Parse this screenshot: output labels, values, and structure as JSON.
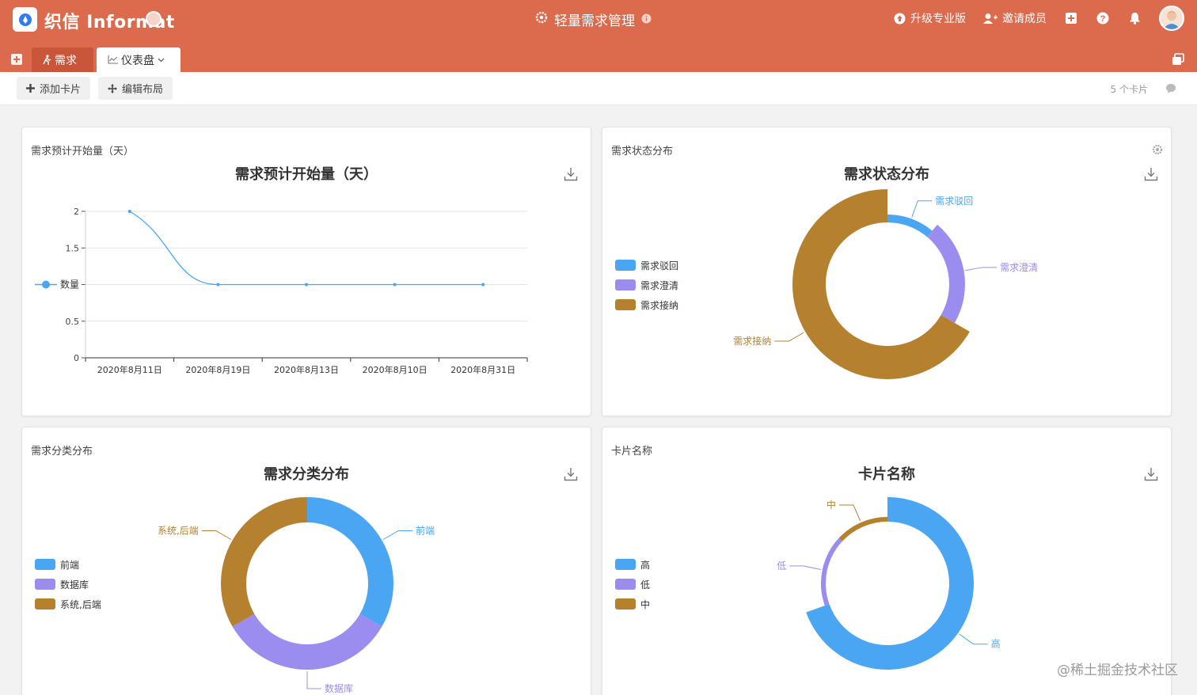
{
  "header": {
    "brand": "织信 Informat",
    "app_title": "轻量需求管理",
    "upgrade": "升级专业版",
    "invite": "邀请成员"
  },
  "tabs": [
    {
      "label": "需求"
    },
    {
      "label": "仪表盘"
    }
  ],
  "toolbar": {
    "add_card": "添加卡片",
    "edit_layout": "编辑布局",
    "card_count": "5 个卡片"
  },
  "colors": {
    "brand": "#dc6a4d",
    "blue": "#4aa6f3",
    "purple": "#9b8cf0",
    "brown": "#b5812f"
  },
  "cards": [
    {
      "label": "需求预计开始量（天）",
      "title": "需求预计开始量（天）"
    },
    {
      "label": "需求状态分布",
      "title": "需求状态分布"
    },
    {
      "label": "需求分类分布",
      "title": "需求分类分布"
    },
    {
      "label": "卡片名称",
      "title": "卡片名称"
    }
  ],
  "chart_data": [
    {
      "type": "line",
      "title": "需求预计开始量（天）",
      "categories": [
        "2020年8月11日",
        "2020年8月19日",
        "2020年8月13日",
        "2020年8月10日",
        "2020年8月31日"
      ],
      "series": [
        {
          "name": "数量",
          "values": [
            2,
            1,
            1,
            1,
            1
          ]
        }
      ],
      "ylim": [
        0,
        2
      ],
      "yticks": [
        "0",
        "0.5",
        "1",
        "1.5",
        "2"
      ],
      "yticks_shown": [
        "0",
        "0.5",
        "",
        "1.5",
        "2"
      ],
      "grid": true,
      "legend": "left"
    },
    {
      "type": "pie",
      "title": "需求状态分布",
      "labels": [
        "需求驳回",
        "需求澄清",
        "需求接纳"
      ],
      "values": [
        1,
        2,
        6
      ],
      "colors": [
        "#4aa6f3",
        "#9b8cf0",
        "#b5812f"
      ],
      "legend": "left"
    },
    {
      "type": "pie",
      "title": "需求分类分布",
      "labels": [
        "前端",
        "数据库",
        "系统,后端"
      ],
      "values": [
        3,
        3,
        3
      ],
      "colors": [
        "#4aa6f3",
        "#9b8cf0",
        "#b5812f"
      ],
      "legend": "left"
    },
    {
      "type": "pie",
      "title": "卡片名称",
      "labels": [
        "高",
        "低",
        "中"
      ],
      "values": [
        16,
        4,
        3
      ],
      "colors": [
        "#4aa6f3",
        "#9b8cf0",
        "#b5812f"
      ],
      "legend": "left"
    }
  ],
  "watermark": "@稀土掘金技术社区"
}
